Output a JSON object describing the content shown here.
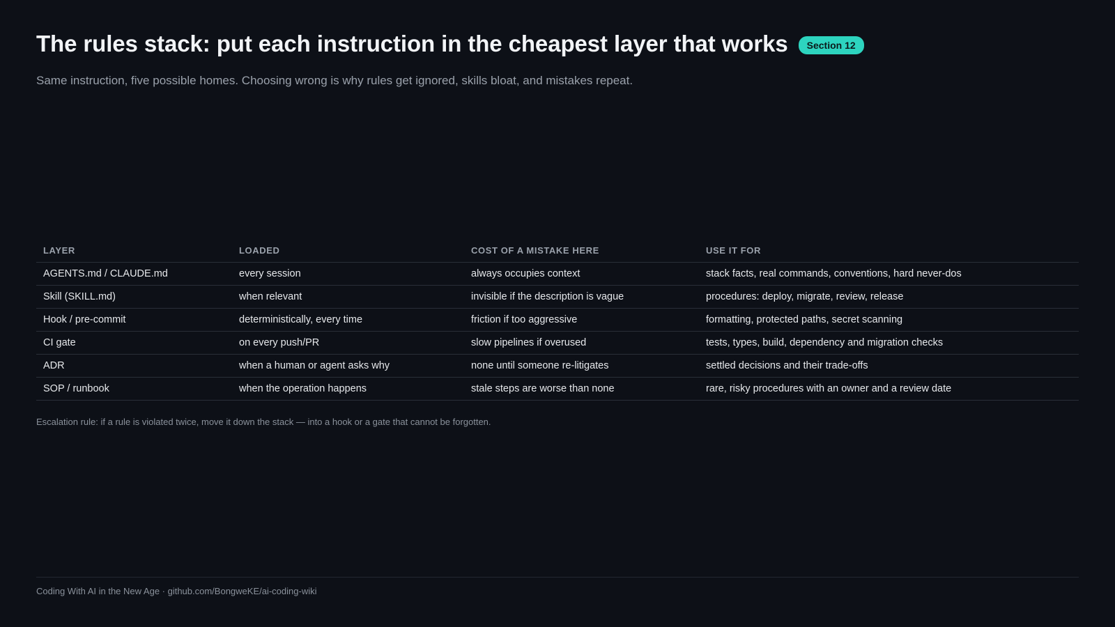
{
  "header": {
    "title": "The rules stack: put each instruction in the cheapest layer that works",
    "badge": "Section 12",
    "subtitle": "Same instruction, five possible homes. Choosing wrong is why rules get ignored, skills bloat, and mistakes repeat."
  },
  "table": {
    "columns": [
      "LAYER",
      "LOADED",
      "COST OF A MISTAKE HERE",
      "USE IT FOR"
    ],
    "rows": [
      [
        "AGENTS.md / CLAUDE.md",
        "every session",
        "always occupies context",
        "stack facts, real commands, conventions, hard never-dos"
      ],
      [
        "Skill (SKILL.md)",
        "when relevant",
        "invisible if the description is vague",
        "procedures: deploy, migrate, review, release"
      ],
      [
        "Hook / pre-commit",
        "deterministically, every time",
        "friction if too aggressive",
        "formatting, protected paths, secret scanning"
      ],
      [
        "CI gate",
        "on every push/PR",
        "slow pipelines if overused",
        "tests, types, build, dependency and migration checks"
      ],
      [
        "ADR",
        "when a human or agent asks why",
        "none until someone re-litigates",
        "settled decisions and their trade-offs"
      ],
      [
        "SOP / runbook",
        "when the operation happens",
        "stale steps are worse than none",
        "rare, risky procedures with an owner and a review date"
      ]
    ]
  },
  "note": "Escalation rule: if a rule is violated twice, move it down the stack — into a hook or a gate that cannot be forgotten.",
  "footer": "Coding With AI in the New Age · github.com/BongweKE/ai-coding-wiki",
  "colors": {
    "background": "#0d1017",
    "accent": "#2dd4bf",
    "text": "#e6e8eb",
    "muted": "#9aa1ab",
    "divider": "#2a2f38"
  }
}
